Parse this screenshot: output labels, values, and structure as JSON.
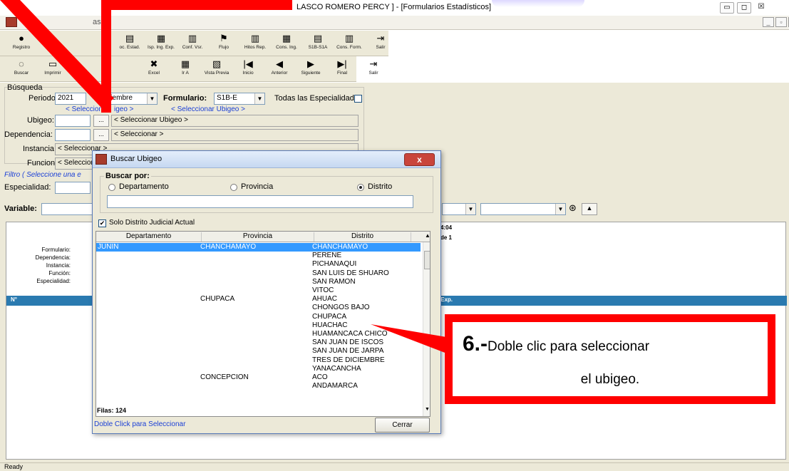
{
  "window": {
    "title": "LASCO ROMERO PERCY ] - [Formularios Estadísticos]",
    "menu_item": "as",
    "btn_minimize": "▭",
    "btn_maximize": "◻",
    "btn_close": "☒",
    "mdi_minimize": "_",
    "mdi_restore": "▫",
    "mdi_close": "×"
  },
  "toolbar1": [
    {
      "label": "Registro",
      "icon": "●"
    },
    {
      "label": "oc. Estad.",
      "icon": "▤"
    },
    {
      "label": "Isp. Ing. Exp.",
      "icon": "▦"
    },
    {
      "label": "Conf. Vsr.",
      "icon": "▥"
    },
    {
      "label": "Flujo",
      "icon": "⚑"
    },
    {
      "label": "Hitos Rep.",
      "icon": "▥"
    },
    {
      "label": "Cons. Ing.",
      "icon": "▦"
    },
    {
      "label": "S1B-S1A",
      "icon": "▤"
    },
    {
      "label": "Cons. Form.",
      "icon": "▥"
    },
    {
      "label": "Salir",
      "icon": "⇥"
    }
  ],
  "toolbar2": [
    {
      "label": "Buscar",
      "icon": "◌"
    },
    {
      "label": "Imprimir",
      "icon": "▭"
    },
    {
      "label": "Excel",
      "icon": "✖"
    },
    {
      "label": "Ir A",
      "icon": "▦"
    },
    {
      "label": "Vista Previa",
      "icon": "▧"
    },
    {
      "label": "Inicio",
      "icon": "|◀"
    },
    {
      "label": "Anterior",
      "icon": "◀"
    },
    {
      "label": "Siguiente",
      "icon": "▶"
    },
    {
      "label": "Final",
      "icon": "▶|"
    },
    {
      "label": "Salir",
      "icon": "⇥"
    }
  ],
  "busqueda": {
    "group_label": "Búsqueda",
    "periodo_label": "Periodo:",
    "periodo_value": "2021",
    "mes_value": "etiembre",
    "formulario_label": "Formulario:",
    "formulario_value": "S1B-E",
    "todas_label": "Todas las Especialidades",
    "sel_ubigeo_hint_1": "< Seleccionar ",
    "sel_ubigeo_hint_1b": "igeo >",
    "sel_ubigeo_hint_2": "< Seleccionar Ubigeo >",
    "ubigeo_label": "Ubigeo:",
    "ubigeo_display": "< Seleccionar Ubigeo >",
    "dependencia_label": "Dependencia:",
    "dependencia_display": "< Seleccionar >",
    "instancia_label": "Instancia:",
    "instancia_display": "< Seleccionar >",
    "funcion_label": "Funcion:",
    "funcion_display": "< Seleccion",
    "browse_label": "..."
  },
  "filtro": {
    "label": "Filtro ( Seleccione una e",
    "especialidad_label": "Especialidad:"
  },
  "variable_label": "Variable:",
  "report": {
    "labels": [
      "Formulario:",
      "Dependencia:",
      "Instancia:",
      "Función:",
      "Especialidad:"
    ],
    "time_fragment": "4:04",
    "page_fragment": "de 1",
    "header_first": "N°",
    "header_last": "t. Exp."
  },
  "status": "Ready",
  "dialog": {
    "title": "Buscar Ubigeo",
    "close": "x",
    "buscar_por": "Buscar por:",
    "radio_departamento": "Departamento",
    "radio_provincia": "Provincia",
    "radio_distrito": "Distrito",
    "solo_distrito": "Solo Distrito Judicial Actual",
    "columns": [
      "Departamento",
      "Provincia",
      "Distrito"
    ],
    "rows": [
      {
        "departamento": "JUNIN",
        "provincia": "CHANCHAMAYO",
        "distrito": "CHANCHAMAYO"
      },
      {
        "departamento": "",
        "provincia": "",
        "distrito": "PERENE"
      },
      {
        "departamento": "",
        "provincia": "",
        "distrito": "PICHANAQUI"
      },
      {
        "departamento": "",
        "provincia": "",
        "distrito": "SAN LUIS DE SHUARO"
      },
      {
        "departamento": "",
        "provincia": "",
        "distrito": "SAN RAMON"
      },
      {
        "departamento": "",
        "provincia": "",
        "distrito": "VITOC"
      },
      {
        "departamento": "",
        "provincia": "CHUPACA",
        "distrito": "AHUAC"
      },
      {
        "departamento": "",
        "provincia": "",
        "distrito": "CHONGOS BAJO"
      },
      {
        "departamento": "",
        "provincia": "",
        "distrito": "CHUPACA"
      },
      {
        "departamento": "",
        "provincia": "",
        "distrito": "HUACHAC"
      },
      {
        "departamento": "",
        "provincia": "",
        "distrito": "HUAMANCACA CHICO"
      },
      {
        "departamento": "",
        "provincia": "",
        "distrito": "SAN JUAN DE ISCOS"
      },
      {
        "departamento": "",
        "provincia": "",
        "distrito": "SAN JUAN DE JARPA"
      },
      {
        "departamento": "",
        "provincia": "",
        "distrito": "TRES DE DICIEMBRE"
      },
      {
        "departamento": "",
        "provincia": "",
        "distrito": "YANACANCHA"
      },
      {
        "departamento": "",
        "provincia": "CONCEPCION",
        "distrito": "ACO"
      },
      {
        "departamento": "",
        "provincia": "",
        "distrito": "ANDAMARCA"
      }
    ],
    "filas": "Filas: 124",
    "hint": "Doble Click para Seleccionar",
    "cerrar": "Cerrar"
  },
  "annotation": {
    "step": "6.-",
    "text1": "Doble clic para seleccionar",
    "text2": "el ubigeo."
  }
}
